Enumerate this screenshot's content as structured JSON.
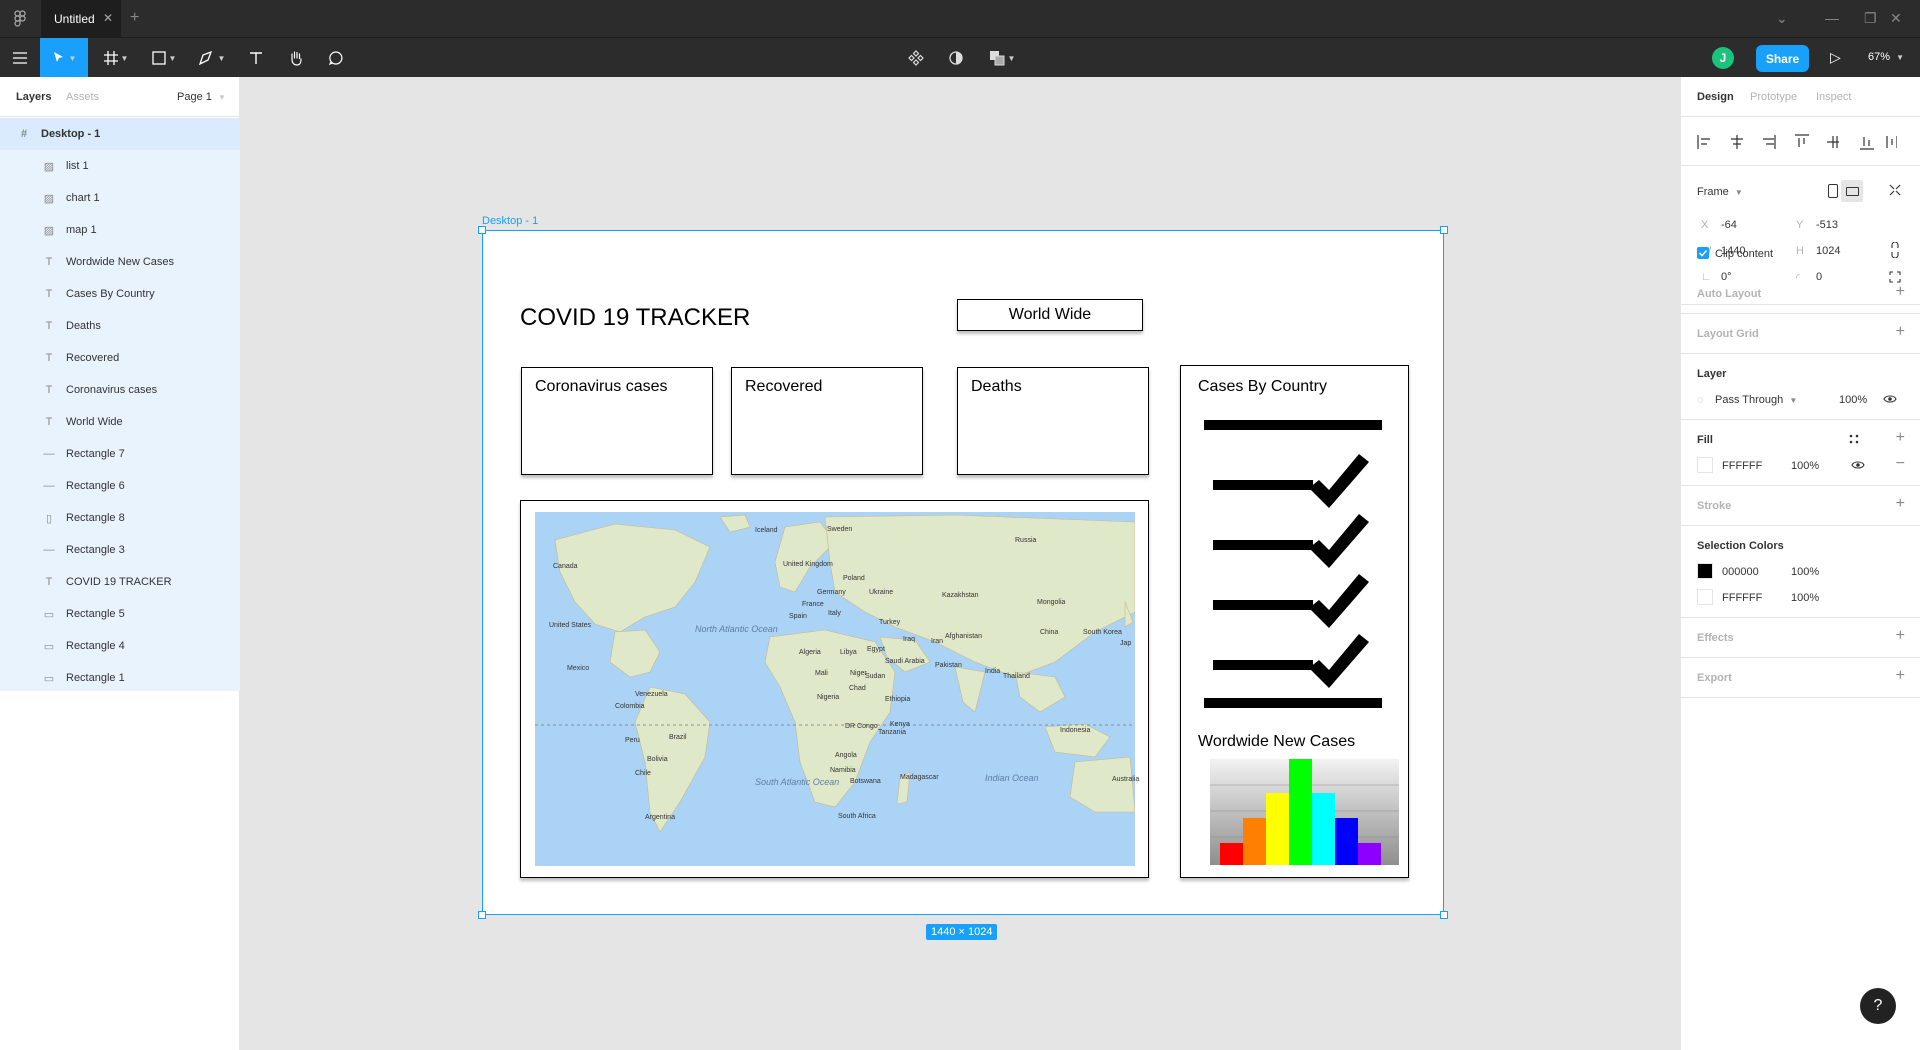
{
  "titlebar": {
    "tab_title": "Untitled",
    "close": "✕",
    "plus": "+"
  },
  "toolbar": {
    "avatar_initial": "J",
    "share_label": "Share",
    "zoom": "67%"
  },
  "left_panel": {
    "tabs": {
      "layers": "Layers",
      "assets": "Assets",
      "page": "Page 1"
    },
    "layers": [
      {
        "name": "Desktop - 1",
        "icon": "frame-icon"
      },
      {
        "name": "list 1",
        "icon": "image-icon"
      },
      {
        "name": "chart 1",
        "icon": "image-icon"
      },
      {
        "name": "map 1",
        "icon": "image-icon"
      },
      {
        "name": "Wordwide New Cases",
        "icon": "text-icon"
      },
      {
        "name": "Cases By Country",
        "icon": "text-icon"
      },
      {
        "name": "Deaths",
        "icon": "text-icon"
      },
      {
        "name": "Recovered",
        "icon": "text-icon"
      },
      {
        "name": "Coronavirus cases",
        "icon": "text-icon"
      },
      {
        "name": "World Wide",
        "icon": "text-icon"
      },
      {
        "name": "Rectangle 7",
        "icon": "line-icon"
      },
      {
        "name": "Rectangle 6",
        "icon": "line-icon"
      },
      {
        "name": "Rectangle 8",
        "icon": "vertical-line-icon"
      },
      {
        "name": "Rectangle 3",
        "icon": "line-icon"
      },
      {
        "name": "COVID 19 TRACKER",
        "icon": "text-icon"
      },
      {
        "name": "Rectangle 5",
        "icon": "rectangle-icon"
      },
      {
        "name": "Rectangle 4",
        "icon": "rectangle-icon"
      },
      {
        "name": "Rectangle 1",
        "icon": "rectangle-icon"
      }
    ]
  },
  "canvas": {
    "frame_label": "Desktop - 1",
    "size_badge": "1440 × 1024",
    "design": {
      "title": "COVID 19 TRACKER",
      "world_wide": "World Wide",
      "cards": [
        "Coronavirus cases",
        "Recovered",
        "Deaths"
      ],
      "cases_by_country": "Cases By Country",
      "worldwide_new_cases": "Wordwide New Cases",
      "map_labels": [
        "Iceland",
        "Sweden",
        "Russia",
        "Canada",
        "United Kingdom",
        "Poland",
        "Germany",
        "Ukraine",
        "Kazakhstan",
        "France",
        "Mongolia",
        "Italy",
        "Spain",
        "Turkey",
        "United States",
        "North Atlantic Ocean",
        "Iraq",
        "Iran",
        "Afghanistan",
        "China",
        "South Korea",
        "Algeria",
        "Libya",
        "Egypt",
        "Saudi Arabia",
        "Pakistan",
        "India",
        "Mexico",
        "Mali",
        "Niger",
        "Sudan",
        "Thailand",
        "Chad",
        "Ethiopia",
        "Venezuela",
        "Nigeria",
        "Colombia",
        "Kenya",
        "DR Congo",
        "Indonesia",
        "Peru",
        "Brazil",
        "Tanzania",
        "Bolivia",
        "Angola",
        "Chile",
        "Namibia",
        "Botswana",
        "Madagascar",
        "Indian Ocean",
        "Australia",
        "South Atlantic Ocean",
        "Argentina",
        "South Africa",
        "Jap"
      ],
      "chart_colors": [
        "#ff0000",
        "#ff7f00",
        "#ffff00",
        "#00ff00",
        "#00ffff",
        "#0000ff",
        "#8b00ff"
      ]
    }
  },
  "right_panel": {
    "tabs": {
      "design": "Design",
      "prototype": "Prototype",
      "inspect": "Inspect"
    },
    "frame": {
      "label": "Frame",
      "x_label": "X",
      "x": "-64",
      "y_label": "Y",
      "y": "-513",
      "w_label": "W",
      "w": "1440",
      "h_label": "H",
      "h": "1024",
      "rotation": "0°",
      "radius": "0",
      "clip_content": "Clip content"
    },
    "auto_layout": "Auto Layout",
    "layout_grid": "Layout Grid",
    "layer": {
      "title": "Layer",
      "blend": "Pass Through",
      "opacity": "100%"
    },
    "fill": {
      "title": "Fill",
      "hex": "FFFFFF",
      "opacity": "100%"
    },
    "stroke": "Stroke",
    "selection_colors": {
      "title": "Selection Colors",
      "colors": [
        {
          "hex": "000000",
          "opacity": "100%",
          "swatch": "#000000"
        },
        {
          "hex": "FFFFFF",
          "opacity": "100%",
          "swatch": "#ffffff"
        }
      ]
    },
    "effects": "Effects",
    "export": "Export"
  },
  "help": "?"
}
